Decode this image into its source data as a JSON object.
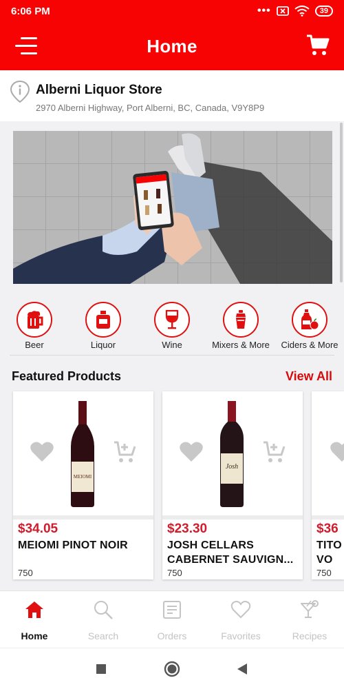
{
  "status_bar": {
    "time": "6:06 PM",
    "dots": "•••",
    "battery": "39"
  },
  "header": {
    "title": "Home"
  },
  "store": {
    "name": "Alberni Liquor Store",
    "address": "2970 Alberni Highway, Port Alberni, BC, Canada, V9Y8P9"
  },
  "categories": [
    {
      "label": "Beer",
      "icon": "beer-mug-icon"
    },
    {
      "label": "Liquor",
      "icon": "liquor-bottle-icon"
    },
    {
      "label": "Wine",
      "icon": "wine-glass-icon"
    },
    {
      "label": "Mixers & More",
      "icon": "cocktail-shaker-icon"
    },
    {
      "label": "Ciders & More",
      "icon": "cider-icon"
    }
  ],
  "featured": {
    "title": "Featured Products",
    "view_all": "View All",
    "products": [
      {
        "price": "$34.05",
        "name": "MEIOMI PINOT NOIR",
        "size": "750",
        "label": "MEIOMI"
      },
      {
        "price": "$23.30",
        "name": "JOSH CELLARS CABERNET SAUVIGN...",
        "size": "750",
        "label": "Josh"
      },
      {
        "price": "$36",
        "name": "TITO VO",
        "size": "750"
      }
    ]
  },
  "nav": {
    "items": [
      {
        "label": "Home",
        "icon": "home-icon",
        "active": true
      },
      {
        "label": "Search",
        "icon": "search-icon",
        "active": false
      },
      {
        "label": "Orders",
        "icon": "orders-icon",
        "active": false
      },
      {
        "label": "Favorites",
        "icon": "heart-icon",
        "active": false
      },
      {
        "label": "Recipes",
        "icon": "cocktail-icon",
        "active": false
      }
    ]
  },
  "colors": {
    "brand": "#f70303",
    "price": "#d01c2c",
    "view_all": "#d60a0a",
    "inactive": "#c4c4c4"
  }
}
